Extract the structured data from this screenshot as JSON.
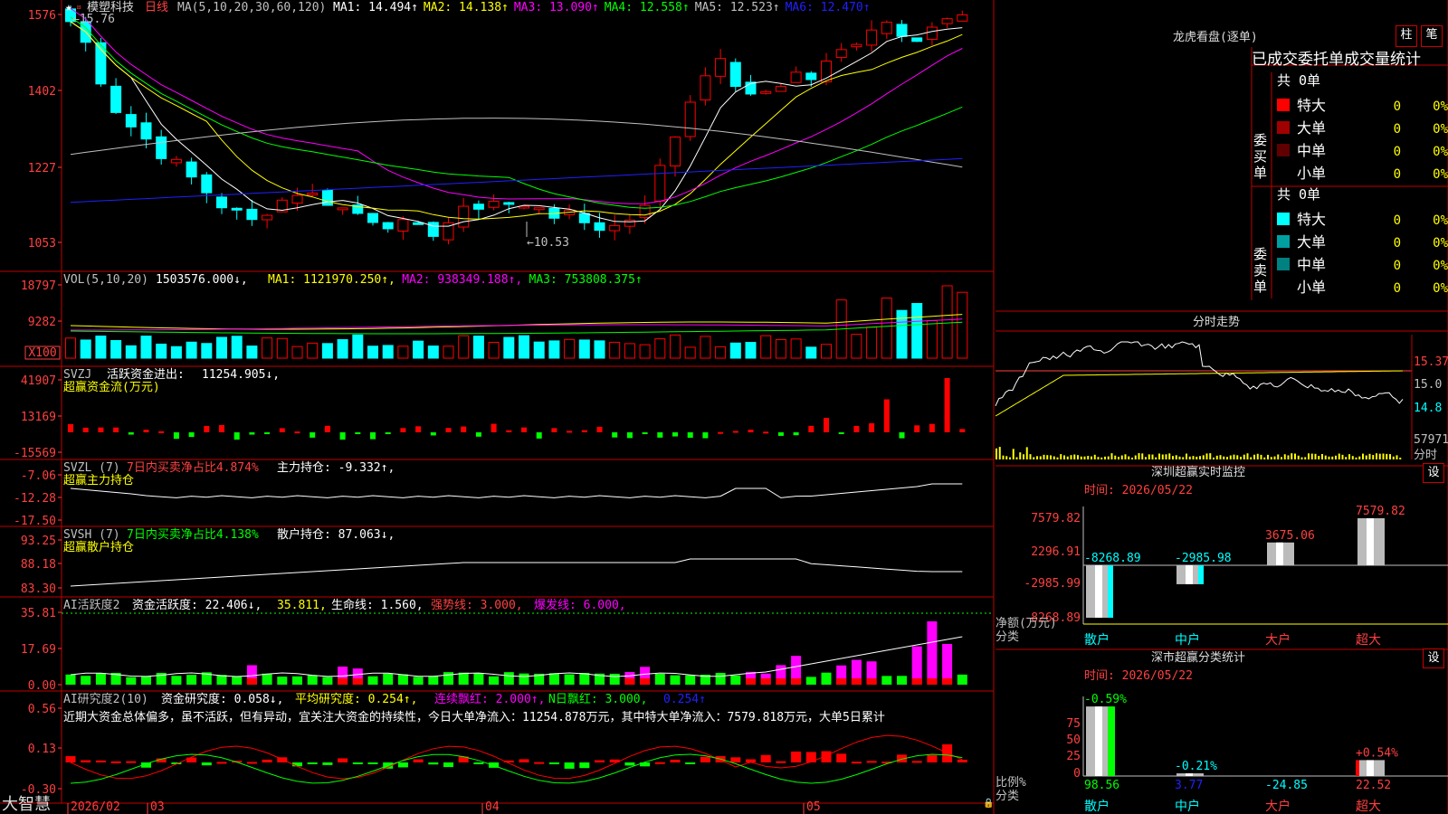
{
  "app": {
    "name": "大智慧"
  },
  "stock": {
    "name": "模塑科技",
    "period": "日线"
  },
  "main_panel": {
    "ma_params": "MA(5,10,20,30,60,120)",
    "ma": [
      {
        "label": "MA1:",
        "value": "14.494↑",
        "color": "#ffffff"
      },
      {
        "label": "MA2:",
        "value": "14.138↑",
        "color": "#ffff00"
      },
      {
        "label": "MA3:",
        "value": "13.090↑",
        "color": "#ff00ff"
      },
      {
        "label": "MA4:",
        "value": "12.558↑",
        "color": "#00ff00"
      },
      {
        "label": "MA5:",
        "value": "12.523↑",
        "color": "#c0c0c0"
      },
      {
        "label": "MA6:",
        "value": "12.470↑",
        "color": "#2020ff"
      }
    ],
    "yaxis": [
      "1576",
      "1402",
      "1227",
      "1053"
    ],
    "high_mark": "15.76",
    "low_mark": "10.53"
  },
  "vol_panel": {
    "title": "VOL(5,10,20)",
    "value": "1503576.000↓,",
    "ma": [
      {
        "label": "MA1:",
        "value": "1121970.250↑,",
        "color": "#ffff00"
      },
      {
        "label": "MA2:",
        "value": "938349.188↑,",
        "color": "#ff00ff"
      },
      {
        "label": "MA3:",
        "value": "753808.375↑",
        "color": "#00ff00"
      }
    ],
    "yaxis": [
      "18797",
      "9282"
    ],
    "unit": "X100"
  },
  "svzj_panel": {
    "title": "SVZJ",
    "label": "活跃资金进出:",
    "value": "11254.905↓,",
    "subtitle": "超赢资金流(万元)",
    "yaxis": [
      "41907",
      "13169",
      "-15569"
    ]
  },
  "svzl_panel": {
    "title": "SVZL (7)",
    "ratio": "7日内买卖净占比4.874%",
    "label": "主力持仓:",
    "value": "-9.332↑,",
    "subtitle": "超赢主力持仓",
    "yaxis": [
      "-7.06",
      "-12.28",
      "-17.50"
    ]
  },
  "svsh_panel": {
    "title": "SVSH (7)",
    "ratio": "7日内买卖净占比4.138%",
    "label": "散户持仓:",
    "value": "87.063↓,",
    "subtitle": "超赢散户持仓",
    "yaxis": [
      "93.25",
      "88.18",
      "83.30"
    ]
  },
  "ai_active_panel": {
    "title": "AI活跃度2",
    "label": "资金活跃度:",
    "value": "22.406↓,",
    "v2": "35.811,",
    "life_label": "生命线:",
    "life_value": "1.560,",
    "strong": "强势线: 3.000,",
    "burst": "爆发线: 6.000,",
    "yaxis": [
      "35.81",
      "17.69",
      "0.00"
    ]
  },
  "ai_research_panel": {
    "title": "AI研究度2(10)",
    "label": "资金研究度:",
    "value": "0.058↓,",
    "avg": "平均研究度: 0.254↑,",
    "cont": "连续飘红: 2.000↑,",
    "nday": "N日飘红: 3.000,",
    "last": "0.254↑",
    "comment": "近期大资金总体偏多，虽不活跃，但有异动，宜关注大资金的持续性，今日大单净流入：11254.878万元，其中特大单净流入：7579.818万元，大单5日累计",
    "yaxis": [
      "0.56",
      "0.13",
      "-0.30"
    ]
  },
  "xaxis": [
    "2026/02",
    "03",
    "04",
    "05"
  ],
  "right_panel": {
    "dragon_title": "龙虎看盘(逐单)",
    "btn_bar": "柱",
    "btn_pen": "笔",
    "stats_title": "已成交委托单成交量统计",
    "buy": {
      "group": "委买单",
      "total": "共 0单",
      "rows": [
        {
          "name": "特大",
          "count": "0",
          "pct": "0%",
          "color": "#ff0000"
        },
        {
          "name": "大单",
          "count": "0",
          "pct": "0%",
          "color": "#a00000"
        },
        {
          "name": "中单",
          "count": "0",
          "pct": "0%",
          "color": "#600000"
        },
        {
          "name": "小单",
          "count": "0",
          "pct": "0%",
          "color": ""
        }
      ]
    },
    "sell": {
      "group": "委卖单",
      "total": "共 0单",
      "rows": [
        {
          "name": "特大",
          "count": "0",
          "pct": "0%",
          "color": "#00ffff"
        },
        {
          "name": "大单",
          "count": "0",
          "pct": "0%",
          "color": "#00a0a0"
        },
        {
          "name": "中单",
          "count": "0",
          "pct": "0%",
          "color": "#008080"
        },
        {
          "name": "小单",
          "count": "0",
          "pct": "0%",
          "color": ""
        }
      ]
    },
    "intraday": {
      "title": "分时走势",
      "yaxis": [
        "15.37",
        "15.0",
        "14.8"
      ],
      "vol": "57971",
      "time_label": "分时"
    },
    "monitor": {
      "title": "深圳超赢实时监控",
      "settings": "设",
      "time": "时间: 2026/05/22",
      "yaxis": [
        "7579.82",
        "2296.91",
        "-2985.99",
        "-8268.89"
      ],
      "ylabel": "净额(万元)",
      "xlabel": "分类",
      "categories": [
        "散户",
        "中户",
        "大户",
        "超大"
      ],
      "values": [
        -8268.89,
        -2985.98,
        3675.06,
        7579.82
      ],
      "value_labels": [
        "-8268.89",
        "-2985.98",
        "3675.06",
        "7579.82"
      ]
    },
    "classify": {
      "title": "深市超赢分类统计",
      "settings": "设",
      "time": "时间: 2026/05/22",
      "yaxis": [
        "75",
        "50",
        "25",
        "0"
      ],
      "ylabel": "比例%",
      "xlabel": "分类",
      "categories": [
        "散户",
        "中户",
        "大户",
        "超大"
      ],
      "top_labels": [
        "-0.59%",
        "-0.21%",
        "",
        "+0.54%"
      ],
      "bottom_labels": [
        "98.56",
        "3.77",
        "-24.85",
        "22.52"
      ],
      "bar_heights": [
        98.56,
        3.77,
        0,
        22.52
      ]
    }
  },
  "colors": {
    "up": "#ff0000",
    "down": "#00ffff",
    "border": "#c00000",
    "bg": "#000000"
  }
}
